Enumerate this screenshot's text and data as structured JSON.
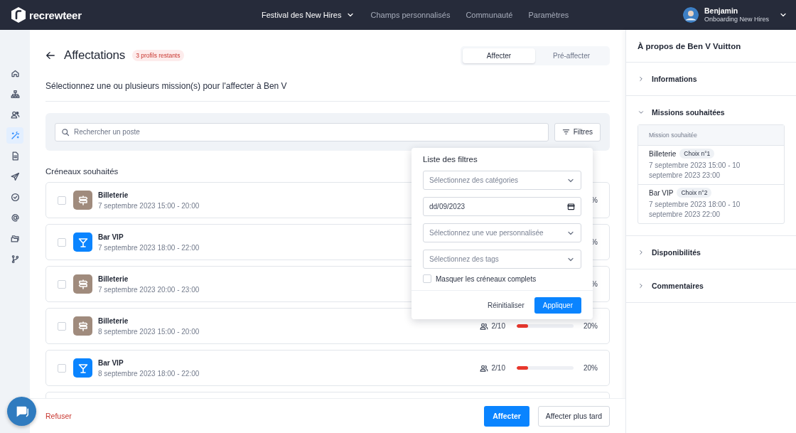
{
  "topbar": {
    "logo": "recrewteer",
    "event_menu": "Festival des New Hires",
    "nav": [
      {
        "label": "Champs personnalisés"
      },
      {
        "label": "Communauté"
      },
      {
        "label": "Paramètres"
      }
    ],
    "user": {
      "name": "Benjamin",
      "subtitle": "Onboarding New Hires"
    }
  },
  "sidebar": {
    "items": [
      {
        "selected": false
      },
      {
        "selected": false
      },
      {
        "selected": false
      },
      {
        "selected": true
      },
      {
        "selected": false
      },
      {
        "selected": false
      },
      {
        "selected": false
      },
      {
        "selected": false
      },
      {
        "selected": false
      },
      {
        "selected": false
      }
    ]
  },
  "page": {
    "title": "Affectations",
    "badge": "3 profils restants",
    "tabs": [
      {
        "label": "Affecter",
        "selected": true
      },
      {
        "label": "Pré-affecter",
        "selected": false
      }
    ],
    "instruction": "Sélectionnez une ou plusieurs mission(s) pour l'affecter à Ben V",
    "search": {
      "placeholder": "Rechercher un poste"
    },
    "filters_button": "Filtres",
    "section_title": "Créneaux souhaités",
    "slots": [
      {
        "kind": "ticket",
        "name": "Billeterie",
        "date": "7 septembre 2023 15:00 - 20:00",
        "checked": false,
        "percent": "%"
      },
      {
        "kind": "bar",
        "name": "Bar VIP",
        "date": "7 septembre 2023 18:00 - 22:00",
        "checked": false,
        "percent": "%"
      },
      {
        "kind": "ticket",
        "name": "Billeterie",
        "date": "7 septembre 2023 20:00 - 23:00",
        "checked": false,
        "percent": "%"
      },
      {
        "kind": "ticket",
        "name": "Billeterie",
        "date": "8 septembre 2023 15:00 - 20:00",
        "checked": false,
        "count": "2/10",
        "level": 0.2,
        "percent": "20%"
      },
      {
        "kind": "bar",
        "name": "Bar VIP",
        "date": "8 septembre 2023 18:00 - 22:00",
        "checked": false,
        "count": "2/10",
        "level": 0.2,
        "percent": "20%"
      }
    ],
    "footer": {
      "refuse": "Refuser",
      "assign": "Affecter",
      "later": "Affecter plus tard"
    }
  },
  "filters_popup": {
    "title": "Liste des filtres",
    "fields": [
      {
        "kind": "select",
        "placeholder": "Sélectionnez des catégories"
      },
      {
        "kind": "date",
        "value": "dd/09/2023"
      },
      {
        "kind": "select",
        "placeholder": "Sélectionnez une vue personnalisée"
      },
      {
        "kind": "select",
        "placeholder": "Sélectionnez des tags"
      }
    ],
    "checkbox": {
      "label": "Masquer les créneaux complets",
      "checked": false
    },
    "reset": "Réinitialiser",
    "apply": "Appliquer"
  },
  "about_panel": {
    "title": "À propos de Ben V Vuitton",
    "sections": [
      {
        "label": "Informations",
        "expanded": false
      },
      {
        "label": "Missions souhaitées",
        "expanded": true,
        "table": {
          "header": "Mission souhaitée",
          "rows": [
            {
              "name": "Billeterie",
              "choice": "Choix n°1",
              "dates": "7 septembre 2023 15:00 - 10 septembre 2023 23:00"
            },
            {
              "name": "Bar VIP",
              "choice": "Choix n°2",
              "dates": "7 septembre 2023 18:00 - 10 septembre 2023 22:00"
            }
          ]
        }
      },
      {
        "label": "Disponibilités",
        "expanded": false
      },
      {
        "label": "Commentaires",
        "expanded": false
      }
    ]
  }
}
